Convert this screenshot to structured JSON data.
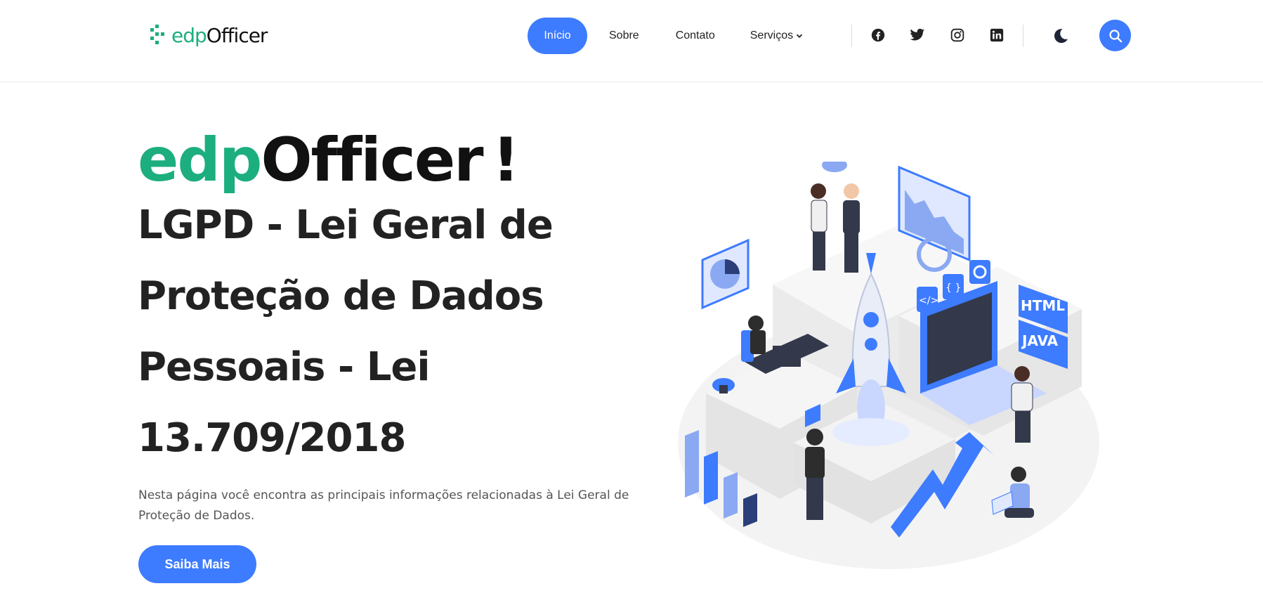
{
  "header": {
    "logo": {
      "prefix": "edp",
      "suffix": "Officer"
    },
    "nav": [
      {
        "label": "Início"
      },
      {
        "label": "Sobre"
      },
      {
        "label": "Contato"
      },
      {
        "label": "Serviços"
      }
    ],
    "social": [
      "facebook-icon",
      "twitter-icon",
      "instagram-icon",
      "linkedin-icon"
    ],
    "theme_toggle": "moon-icon",
    "search": "search-icon"
  },
  "hero": {
    "brand": {
      "prefix": "edp",
      "suffix": "Officer",
      "mark": "!"
    },
    "title_lines": [
      "LGPD - Lei Geral de",
      "Proteção de Dados",
      "Pessoais - Lei",
      "13.709/2018"
    ],
    "description_lines": [
      "Nesta página você encontra as principais informações relacionadas à Lei Geral de",
      "Proteção de Dados."
    ],
    "cta_label": "Saiba Mais"
  },
  "illustration": {
    "badges": [
      "HTML",
      "JAVA"
    ],
    "code_symbols": [
      "</>",
      "{ }"
    ]
  },
  "colors": {
    "accent": "#3d7bff",
    "brand_green": "#1cae7f",
    "text_dark": "#222222"
  }
}
